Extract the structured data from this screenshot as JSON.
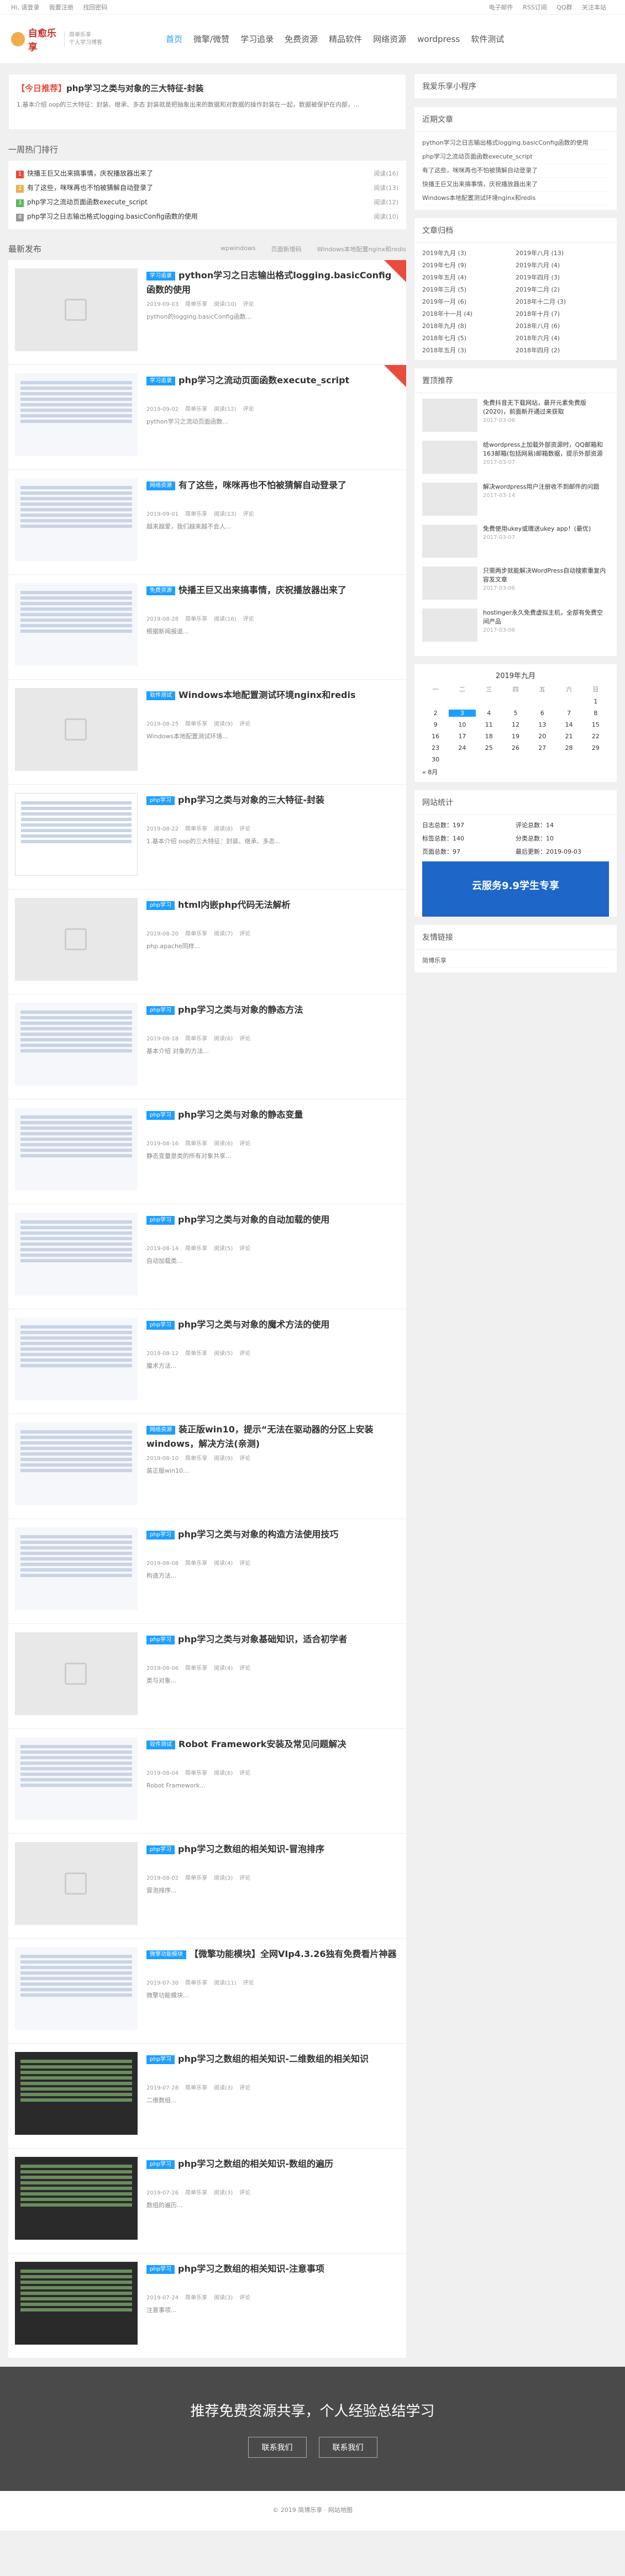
{
  "topbar": {
    "left": [
      "Hi, 请登录",
      "我要注册",
      "找回密码"
    ],
    "right": [
      "电子邮件",
      "RSS订阅",
      "QQ群",
      "关注本站"
    ]
  },
  "logo": {
    "name": "自愈乐享",
    "sub1": "简单乐享",
    "sub2": "个人学习博客"
  },
  "nav": [
    "首页",
    "微擎/微赞",
    "学习追录",
    "免费资源",
    "精品软件",
    "网络资源",
    "wordpress",
    "软件测试"
  ],
  "notice": {
    "tag": "【今日推荐】",
    "title": "php学习之类与对象的三大特征-封装",
    "text": "1.基本介绍 oop的三大特征：封装、继承、多态 封装就是把抽象出来的数据和对数据的操作封装在一起，数据被保护在内部，..."
  },
  "hot": {
    "title": "一周热门排行",
    "items": [
      {
        "n": "1",
        "t": "快播王巨又出来搞事情，庆祝播放器出来了",
        "v": "阅读(16)",
        "c": "#e74c3c"
      },
      {
        "n": "2",
        "t": "有了这些，咪咪再也不怕被猜解自动登录了",
        "v": "阅读(13)",
        "c": "#f0ad4e"
      },
      {
        "n": "3",
        "t": "php学习之流动页面函数execute_script",
        "v": "阅读(12)",
        "c": "#5cb85c"
      },
      {
        "n": "4",
        "t": "php学习之日志输出格式logging.basicConfig函数的使用",
        "v": "阅读(10)",
        "c": "#999"
      }
    ]
  },
  "latest": {
    "title": "最新发布",
    "tabs": [
      "wpwindows",
      "页面新增码",
      "Windows本地配置nginx和redis"
    ]
  },
  "articles": [
    {
      "cat": "学习追录",
      "title": "python学习之日志输出格式logging.basicConfig函数的使用",
      "date": "2019-09-03",
      "author": "简单乐享",
      "views": "阅读(10)",
      "cmt": "评论",
      "desc": "python的logging.basicConfig函数...",
      "thumb": "ph",
      "ribbon": true
    },
    {
      "cat": "学习追录",
      "title": "php学习之流动页面函数execute_script",
      "date": "2019-09-02",
      "author": "简单乐享",
      "views": "阅读(12)",
      "cmt": "评论",
      "desc": "python学习之流动页面函数...",
      "thumb": "screen",
      "ribbon": true
    },
    {
      "cat": "网络资源",
      "title": "有了这些，咪咪再也不怕被猜解自动登录了",
      "date": "2019-09-01",
      "author": "简单乐享",
      "views": "阅读(13)",
      "cmt": "评论",
      "desc": "越来越爱，我们越来越不会人...",
      "thumb": "screen",
      "ribbon": false
    },
    {
      "cat": "免费资源",
      "title": "快播王巨又出来搞事情，庆祝播放器出来了",
      "date": "2019-08-28",
      "author": "简单乐享",
      "views": "阅读(16)",
      "cmt": "评论",
      "desc": "根据新闻报道...",
      "thumb": "screen",
      "ribbon": false
    },
    {
      "cat": "软件测试",
      "title": "Windows本地配置测试环境nginx和redis",
      "date": "2019-08-25",
      "author": "简单乐享",
      "views": "阅读(9)",
      "cmt": "评论",
      "desc": "Windows本地配置测试环境...",
      "thumb": "ph",
      "ribbon": false
    },
    {
      "cat": "php学习",
      "title": "php学习之类与对象的三大特征-封装",
      "date": "2019-08-22",
      "author": "简单乐享",
      "views": "阅读(8)",
      "cmt": "评论",
      "desc": "1.基本介绍 oop的三大特征：封装、继承、多态...",
      "thumb": "table",
      "ribbon": false
    },
    {
      "cat": "php学习",
      "title": "html内嵌php代码无法解析",
      "date": "2019-08-20",
      "author": "简单乐享",
      "views": "阅读(7)",
      "cmt": "评论",
      "desc": "php.apache同样...",
      "thumb": "ph",
      "ribbon": false
    },
    {
      "cat": "php学习",
      "title": "php学习之类与对象的静态方法",
      "date": "2019-08-18",
      "author": "简单乐享",
      "views": "阅读(6)",
      "cmt": "评论",
      "desc": "基本介绍 对象的方法...",
      "thumb": "screen",
      "ribbon": false
    },
    {
      "cat": "php学习",
      "title": "php学习之类与对象的静态变量",
      "date": "2019-08-16",
      "author": "简单乐享",
      "views": "阅读(6)",
      "cmt": "评论",
      "desc": "静态变量是类的所有对象共享...",
      "thumb": "screen",
      "ribbon": false
    },
    {
      "cat": "php学习",
      "title": "php学习之类与对象的自动加载的使用",
      "date": "2019-08-14",
      "author": "简单乐享",
      "views": "阅读(5)",
      "cmt": "评论",
      "desc": "自动加载类...",
      "thumb": "screen",
      "ribbon": false
    },
    {
      "cat": "php学习",
      "title": "php学习之类与对象的魔术方法的使用",
      "date": "2019-08-12",
      "author": "简单乐享",
      "views": "阅读(5)",
      "cmt": "评论",
      "desc": "魔术方法...",
      "thumb": "screen",
      "ribbon": false
    },
    {
      "cat": "网络资源",
      "title": "装正版win10，提示“无法在驱动器的分区上安装windows，解决方法(亲测)",
      "date": "2019-08-10",
      "author": "简单乐享",
      "views": "阅读(9)",
      "cmt": "评论",
      "desc": "装正版win10...",
      "thumb": "screen",
      "ribbon": false
    },
    {
      "cat": "php学习",
      "title": "php学习之类与对象的构造方法使用技巧",
      "date": "2019-08-08",
      "author": "简单乐享",
      "views": "阅读(4)",
      "cmt": "评论",
      "desc": "构造方法...",
      "thumb": "screen",
      "ribbon": false
    },
    {
      "cat": "php学习",
      "title": "php学习之类与对象基础知识，适合初学者",
      "date": "2019-08-06",
      "author": "简单乐享",
      "views": "阅读(4)",
      "cmt": "评论",
      "desc": "类与对象...",
      "thumb": "ph",
      "ribbon": false
    },
    {
      "cat": "软件测试",
      "title": "Robot Framework安装及常见问题解决",
      "date": "2019-08-04",
      "author": "简单乐享",
      "views": "阅读(6)",
      "cmt": "评论",
      "desc": "Robot Framework...",
      "thumb": "screen",
      "ribbon": false
    },
    {
      "cat": "php学习",
      "title": "php学习之数组的相关知识-冒泡排序",
      "date": "2019-08-02",
      "author": "简单乐享",
      "views": "阅读(3)",
      "cmt": "评论",
      "desc": "冒泡排序...",
      "thumb": "ph",
      "ribbon": false
    },
    {
      "cat": "微擎功能模块",
      "title": "【微擎功能模块】全网VIp4.3.26独有免费看片神器",
      "date": "2019-07-30",
      "author": "简单乐享",
      "views": "阅读(11)",
      "cmt": "评论",
      "desc": "微擎功能模块...",
      "thumb": "screen",
      "ribbon": false
    },
    {
      "cat": "php学习",
      "title": "php学习之数组的相关知识-二维数组的相关知识",
      "date": "2019-07-28",
      "author": "简单乐享",
      "views": "阅读(3)",
      "cmt": "评论",
      "desc": "二维数组...",
      "thumb": "dark",
      "ribbon": false
    },
    {
      "cat": "php学习",
      "title": "php学习之数组的相关知识-数组的遍历",
      "date": "2019-07-26",
      "author": "简单乐享",
      "views": "阅读(3)",
      "cmt": "评论",
      "desc": "数组的遍历...",
      "thumb": "dark",
      "ribbon": false
    },
    {
      "cat": "php学习",
      "title": "php学习之数组的相关知识-注意事项",
      "date": "2019-07-24",
      "author": "简单乐享",
      "views": "阅读(3)",
      "cmt": "评论",
      "desc": "注意事项...",
      "thumb": "dark",
      "ribbon": false
    }
  ],
  "side": {
    "mini": "我爱乐享小程序",
    "recent_title": "近期文章",
    "recent": [
      "python学习之日志输出格式logging.basicConfig函数的使用",
      "php学习之流动页面函数execute_script",
      "有了这些，咪咪再也不怕被猜解自动登录了",
      "快播王巨又出来搞事情，庆祝播放器出来了",
      "Windows本地配置测试环境nginx和redis"
    ],
    "archive_title": "文章归档",
    "archive": [
      "2019年九月 (3)",
      "2019年八月 (13)",
      "2019年七月 (9)",
      "2019年六月 (4)",
      "2019年五月 (4)",
      "2019年四月 (3)",
      "2019年三月 (5)",
      "2019年二月 (2)",
      "2019年一月 (6)",
      "2018年十二月 (3)",
      "2018年十一月 (4)",
      "2018年十月 (7)",
      "2018年九月 (8)",
      "2018年八月 (6)",
      "2018年七月 (5)",
      "2018年六月 (4)",
      "2018年五月 (3)",
      "2018年四月 (2)"
    ],
    "rec_title": "置顶推荐",
    "rec": [
      {
        "t": "免费抖音无下载网站，最开元素免费版(2020)，前面新开通过来获取",
        "d": "2017-03-06"
      },
      {
        "t": "给wordpress上加载外部资源时，QQ邮箱和163邮箱(包括网易)邮箱数据，提示外部资源",
        "d": "2017-03-07"
      },
      {
        "t": "解决wordpress用户注册收不到邮件的问题",
        "d": "2017-03-14"
      },
      {
        "t": "免费使用ukey或赠送ukey app！(最优)",
        "d": "2017-03-07"
      },
      {
        "t": "只需两步就能解决WordPress自动搜索重复内容发文章",
        "d": "2017-03-06"
      },
      {
        "t": "hostinger永久免费虚拟主机，全部有免费空间产品",
        "d": "2017-03-06"
      }
    ],
    "cal_head": "2019年九月",
    "cal_days": [
      "一",
      "二",
      "三",
      "四",
      "五",
      "六",
      "日"
    ],
    "cal": [
      "",
      "",
      "",
      "",
      "",
      "",
      "1",
      "2",
      "3",
      "4",
      "5",
      "6",
      "7",
      "8",
      "9",
      "10",
      "11",
      "12",
      "13",
      "14",
      "15",
      "16",
      "17",
      "18",
      "19",
      "20",
      "21",
      "22",
      "23",
      "24",
      "25",
      "26",
      "27",
      "28",
      "29",
      "30",
      "",
      "",
      "",
      "",
      ""
    ],
    "cal_prev": "« 8月",
    "stats_title": "网站统计",
    "stats": [
      "日志总数：197",
      "评论总数：14",
      "标签总数：140",
      "分类总数：10",
      "页面总数：97",
      "最后更新：2019-09-03"
    ],
    "ad": "云服务9.9学生专享",
    "links_title": "友情链接",
    "links": [
      "简博乐享"
    ]
  },
  "footer": {
    "title": "推荐免费资源共享，个人经验总结学习",
    "btn1": "联系我们",
    "btn2": "联系我们",
    "copy": "© 2019 简博乐享 · 网站地图"
  }
}
